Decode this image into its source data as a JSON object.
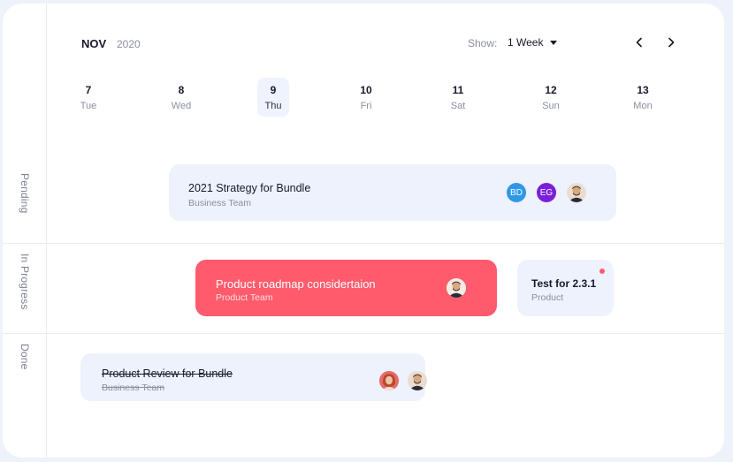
{
  "header": {
    "month": "NOV",
    "year": "2020",
    "show_label": "Show:",
    "show_value": "1 Week",
    "prev_icon": "chevron-left-icon",
    "next_icon": "chevron-right-icon"
  },
  "days": [
    {
      "num": "7",
      "name": "Tue",
      "active": false
    },
    {
      "num": "8",
      "name": "Wed",
      "active": false
    },
    {
      "num": "9",
      "name": "Thu",
      "active": true
    },
    {
      "num": "10",
      "name": "Fri",
      "active": false
    },
    {
      "num": "11",
      "name": "Sat",
      "active": false
    },
    {
      "num": "12",
      "name": "Sun",
      "active": false
    },
    {
      "num": "13",
      "name": "Mon",
      "active": false
    }
  ],
  "lanes": {
    "pending": "Pending",
    "in_progress": "In Progress",
    "done": "Done"
  },
  "tasks": {
    "strategy": {
      "title": "2021 Strategy for Bundle",
      "subtitle": "Business Team",
      "avatars": [
        {
          "initials": "BD",
          "color": "#2f97e8"
        },
        {
          "initials": "EG",
          "color": "#7a1fd8"
        },
        {
          "icon": "user-photo-avatar"
        }
      ]
    },
    "roadmap": {
      "title": "Product roadmap considertaion",
      "subtitle": "Product Team",
      "color": "#ff5b6c"
    },
    "test": {
      "title": "Test for 2.3.1",
      "subtitle": "Product",
      "notification_color": "#ff5b6c"
    },
    "review": {
      "title": "Product Review for Bundle",
      "subtitle": "Business Team"
    }
  },
  "colors": {
    "background": "#eef2fb",
    "card": "#ffffff",
    "task_light": "#edf2fc",
    "accent_red": "#ff5b6c"
  }
}
